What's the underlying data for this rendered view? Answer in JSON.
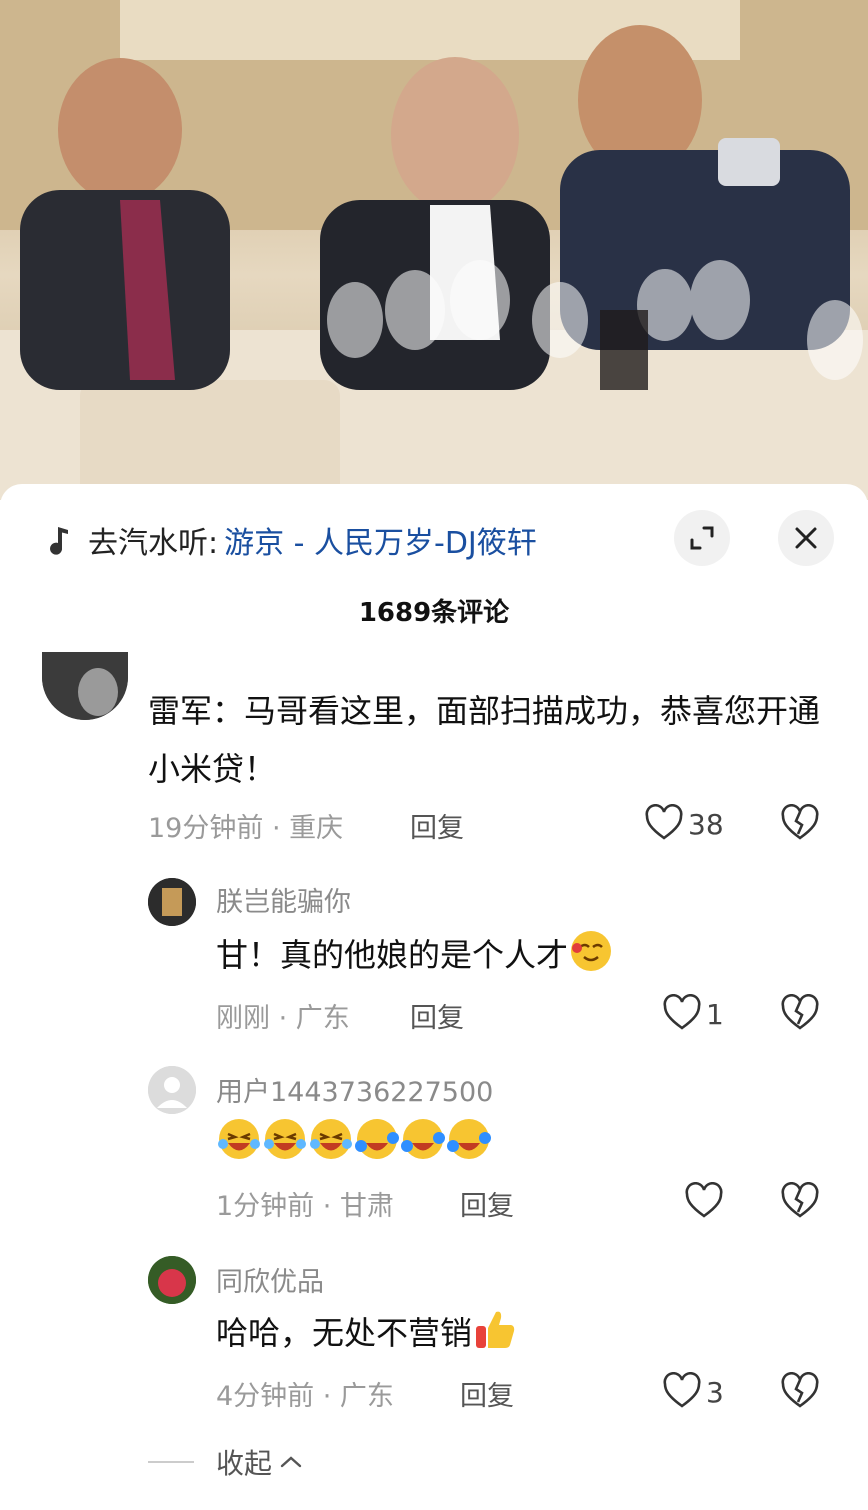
{
  "music_bar": {
    "prefix": "去汽水听:",
    "song": "游京 - 人民万岁-DJ筱轩"
  },
  "comments_header": {
    "title": "1689条评论"
  },
  "comments": [
    {
      "text": "雷军：马哥看这里，面部扫描成功，恭喜您开通小米贷！",
      "time": "19分钟前 · 重庆",
      "reply": "回复",
      "likes": "38"
    },
    {
      "user": "朕岂能骗你",
      "text": "甘！真的他娘的是个人才",
      "time": "刚刚 · 广东",
      "reply": "回复",
      "likes": "1"
    },
    {
      "user": "用户1443736227500",
      "text": "",
      "time": "1分钟前 · 甘肃",
      "reply": "回复",
      "likes": ""
    },
    {
      "user": "同欣优品",
      "text": "哈哈，无处不营销",
      "time": "4分钟前 · 广东",
      "reply": "回复",
      "likes": "3"
    }
  ],
  "collapse": {
    "label": "收起"
  },
  "icons": [
    "music-note-icon",
    "expand-icon",
    "close-icon",
    "heart-icon",
    "broken-heart-icon",
    "laughing-emoji-icon",
    "tears-of-joy-emoji-icon",
    "thumbs-up-emoji-icon"
  ]
}
